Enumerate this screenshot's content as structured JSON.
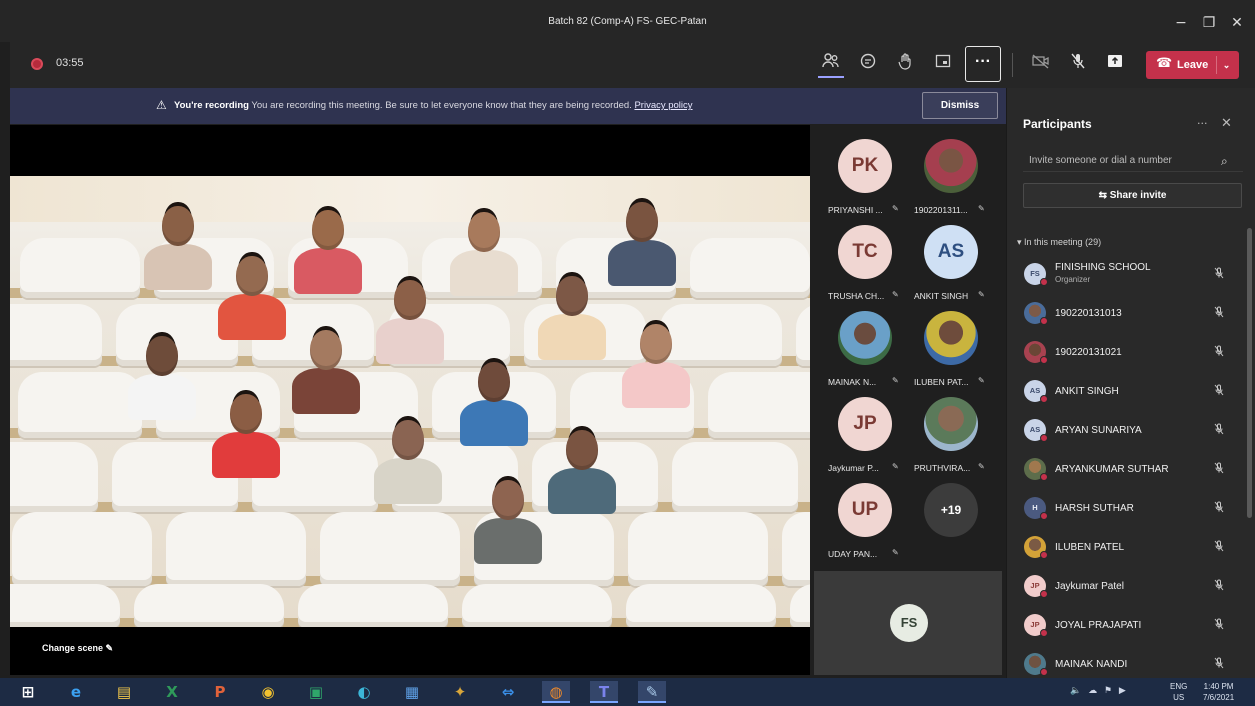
{
  "window": {
    "title": "Batch 82 (Comp-A) FS- GEC-Patan",
    "minimize_glyph": "−",
    "maximize_glyph": "❐",
    "close_glyph": "✕"
  },
  "controls": {
    "timer": "03:55",
    "icons": [
      "people-icon",
      "chat-icon",
      "raise-hand-icon",
      "rooms-icon"
    ],
    "more_glyph": "···",
    "leave_label": "Leave",
    "leave_caret": "⌄"
  },
  "banner": {
    "title": "You're recording",
    "message": "You are recording this meeting. Be sure to let everyone know that they are being recorded.",
    "link": "Privacy policy",
    "dismiss_label": "Dismiss"
  },
  "stage": {
    "change_scene_label": "Change scene ✎"
  },
  "gallery": {
    "tiles": [
      {
        "initials": "PK",
        "name": "PRIYANSHI ...",
        "style": "pink"
      },
      {
        "initials": "",
        "name": "1902201311...",
        "style": "photo3"
      },
      {
        "initials": "TC",
        "name": "TRUSHA CH...",
        "style": "pink"
      },
      {
        "initials": "AS",
        "name": "ANKIT SINGH",
        "style": "blue"
      },
      {
        "initials": "",
        "name": "MAINAK N...",
        "style": "photo4"
      },
      {
        "initials": "",
        "name": "ILUBEN PAT...",
        "style": "photo2"
      },
      {
        "initials": "JP",
        "name": "Jaykumar P...",
        "style": "pink"
      },
      {
        "initials": "",
        "name": "PRUTHVIRA...",
        "style": "photo"
      },
      {
        "initials": "UP",
        "name": "UDAY PAN...",
        "style": "pink"
      },
      {
        "initials": "+19",
        "name": "",
        "style": "more"
      }
    ],
    "self_initials": "FS"
  },
  "participants": {
    "title": "Participants",
    "invite_placeholder": "Invite someone or dial a number",
    "share_label": "Share invite",
    "section_label": "In this meeting (29)",
    "list": [
      {
        "name": "FINISHING SCHOOL",
        "role": "Organizer",
        "initials": "FS",
        "style": "blue"
      },
      {
        "name": "190220131013",
        "role": "",
        "initials": "",
        "style": "photo"
      },
      {
        "name": "190220131021",
        "role": "",
        "initials": "",
        "style": "photo2"
      },
      {
        "name": "ANKIT SINGH",
        "role": "",
        "initials": "AS",
        "style": "blue"
      },
      {
        "name": "ARYAN SUNARIYA",
        "role": "",
        "initials": "AS",
        "style": "blue"
      },
      {
        "name": "ARYANKUMAR SUTHAR",
        "role": "",
        "initials": "",
        "style": "photo3"
      },
      {
        "name": "HARSH SUTHAR",
        "role": "",
        "initials": "H",
        "style": "dark"
      },
      {
        "name": "ILUBEN PATEL",
        "role": "",
        "initials": "",
        "style": "photo4"
      },
      {
        "name": "Jaykumar Patel",
        "role": "",
        "initials": "JP",
        "style": "pink"
      },
      {
        "name": "JOYAL PRAJAPATI",
        "role": "",
        "initials": "JP",
        "style": "pink"
      },
      {
        "name": "MAINAK NANDI",
        "role": "",
        "initials": "",
        "style": "photo5"
      }
    ]
  },
  "taskbar": {
    "apps": [
      "windows-start-icon",
      "edge-legacy-icon",
      "file-explorer-icon",
      "excel-icon",
      "powerpoint-icon",
      "chrome-icon",
      "store-icon",
      "edge-icon",
      "calculator-icon",
      "winrar-icon",
      "teamviewer-icon",
      "firefox-icon",
      "teams-icon",
      "paint-icon"
    ],
    "lang_line1": "ENG",
    "lang_line2": "US",
    "time": "1:40 PM",
    "date": "7/6/2021"
  }
}
